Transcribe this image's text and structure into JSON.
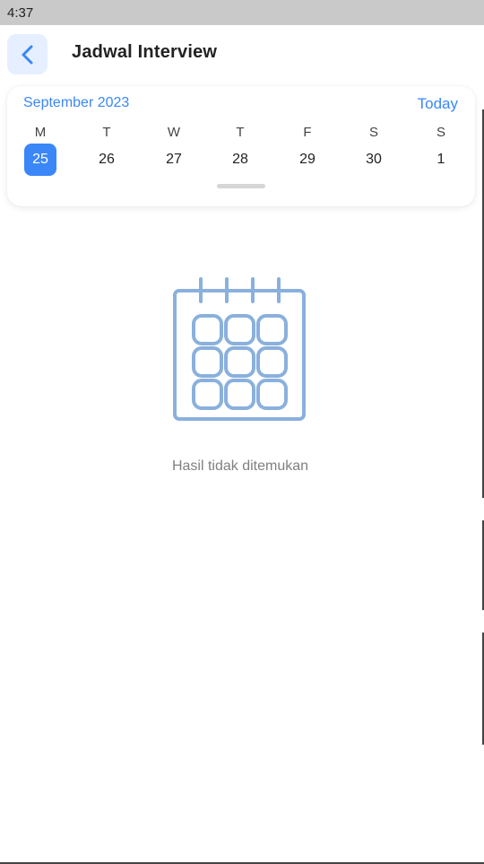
{
  "status_bar": {
    "time": "4:37"
  },
  "header": {
    "title": "Jadwal Interview",
    "back_icon": "chevron-left-icon"
  },
  "calendar": {
    "month": "September 2023",
    "today_label": "Today",
    "weekdays": [
      "M",
      "T",
      "W",
      "T",
      "F",
      "S",
      "S"
    ],
    "dates": [
      "25",
      "26",
      "27",
      "28",
      "29",
      "30",
      "1"
    ],
    "selected_date": "25"
  },
  "empty_state": {
    "icon": "calendar-icon",
    "message": "Hasil tidak ditemukan"
  },
  "colors": {
    "accent": "#3b87f7",
    "back_button_bg": "#e6efff",
    "icon_stroke": "#8ab0dd",
    "status_bar_bg": "#c9c9c9"
  }
}
